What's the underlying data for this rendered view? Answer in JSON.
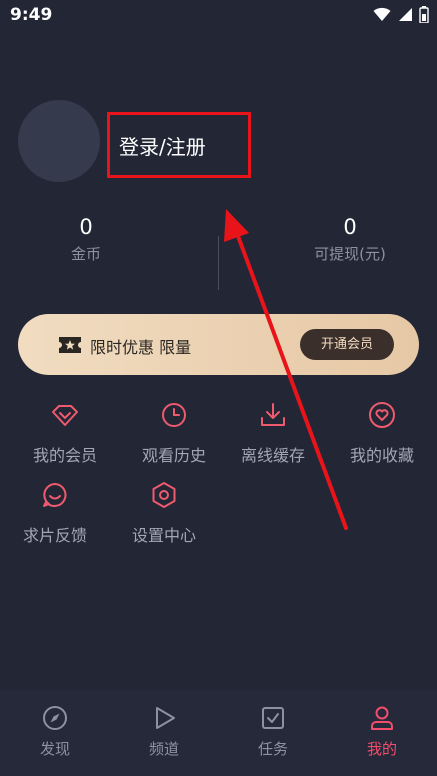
{
  "status_bar": {
    "time": "9:49",
    "icons": [
      "wifi-icon",
      "signal-icon",
      "battery-icon"
    ]
  },
  "profile": {
    "login_label": "登录/注册"
  },
  "stats": {
    "coins": {
      "value": "0",
      "label": "金币"
    },
    "cash": {
      "value": "0",
      "label": "可提现(元)"
    }
  },
  "vip_banner": {
    "text": "限时优惠 限量",
    "button_label": "开通会员",
    "icon": "ticket-star-icon"
  },
  "menu": [
    {
      "label": "我的会员",
      "icon": "diamond-icon"
    },
    {
      "label": "观看历史",
      "icon": "clock-icon"
    },
    {
      "label": "离线缓存",
      "icon": "download-icon"
    },
    {
      "label": "我的收藏",
      "icon": "heart-icon"
    },
    {
      "label": "求片反馈",
      "icon": "chat-icon"
    },
    {
      "label": "设置中心",
      "icon": "settings-hexagon-icon"
    }
  ],
  "bottom_nav": [
    {
      "label": "发现",
      "icon": "compass-icon",
      "active": false
    },
    {
      "label": "频道",
      "icon": "play-icon",
      "active": false
    },
    {
      "label": "任务",
      "icon": "task-icon",
      "active": false
    },
    {
      "label": "我的",
      "icon": "user-icon",
      "active": true
    }
  ],
  "colors": {
    "background": "#232635",
    "accent_red": "#f24d6b",
    "icon_red": "#ee5a6e",
    "annotation_red": "#e8141a",
    "vip_gold": "#f1dcc1"
  }
}
